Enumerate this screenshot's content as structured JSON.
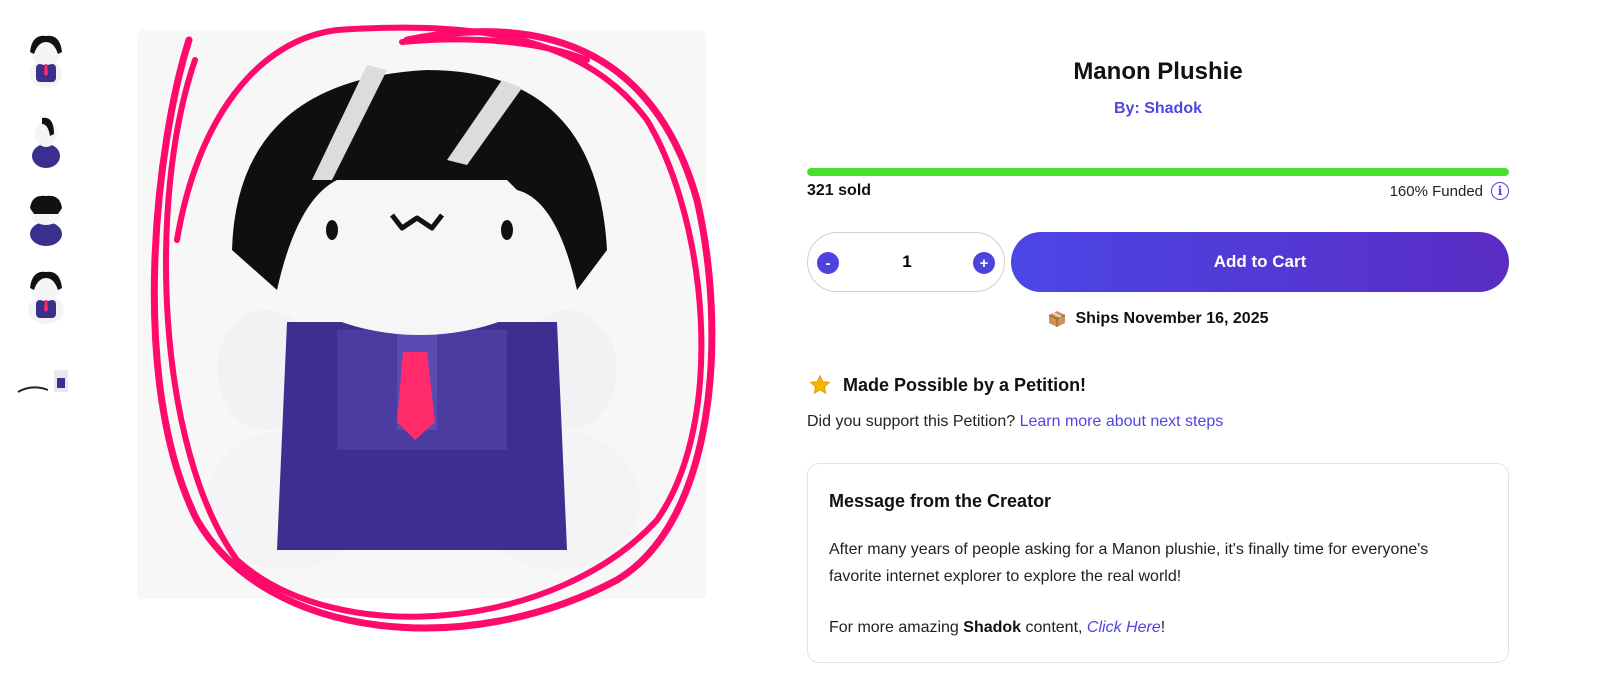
{
  "product": {
    "title": "Manon Plushie",
    "byline": "By: Shadok",
    "sold": "321 sold",
    "funded_text": "160% Funded",
    "funded_percent": 160,
    "progress_fill_fraction": 1.0
  },
  "thumbnails": [
    {
      "name": "front-view"
    },
    {
      "name": "side-view"
    },
    {
      "name": "back-view"
    },
    {
      "name": "angled-view"
    },
    {
      "name": "size-comparison"
    }
  ],
  "cart": {
    "minus_label": "-",
    "plus_label": "+",
    "quantity": "1",
    "add_to_cart_label": "Add to Cart",
    "ships_text": "Ships November 16, 2025"
  },
  "petition": {
    "heading": "Made Possible by a Petition!",
    "question": "Did you support this Petition?",
    "link_text": "Learn more about next steps"
  },
  "creator": {
    "heading": "Message from the Creator",
    "message": "After many years of people asking for a Manon plushie, it's finally time for everyone's favorite internet explorer to explore the real world!",
    "more_prefix": "For more amazing",
    "more_name": "Shadok",
    "more_mid": "content,",
    "more_link": "Click Here",
    "more_suffix": "!"
  },
  "colors": {
    "accent": "#5145e0",
    "progress": "#48e02c",
    "scribble": "#ff0a6c",
    "cart_gradient_start": "#4b46e6",
    "cart_gradient_end": "#5a2cc4"
  }
}
